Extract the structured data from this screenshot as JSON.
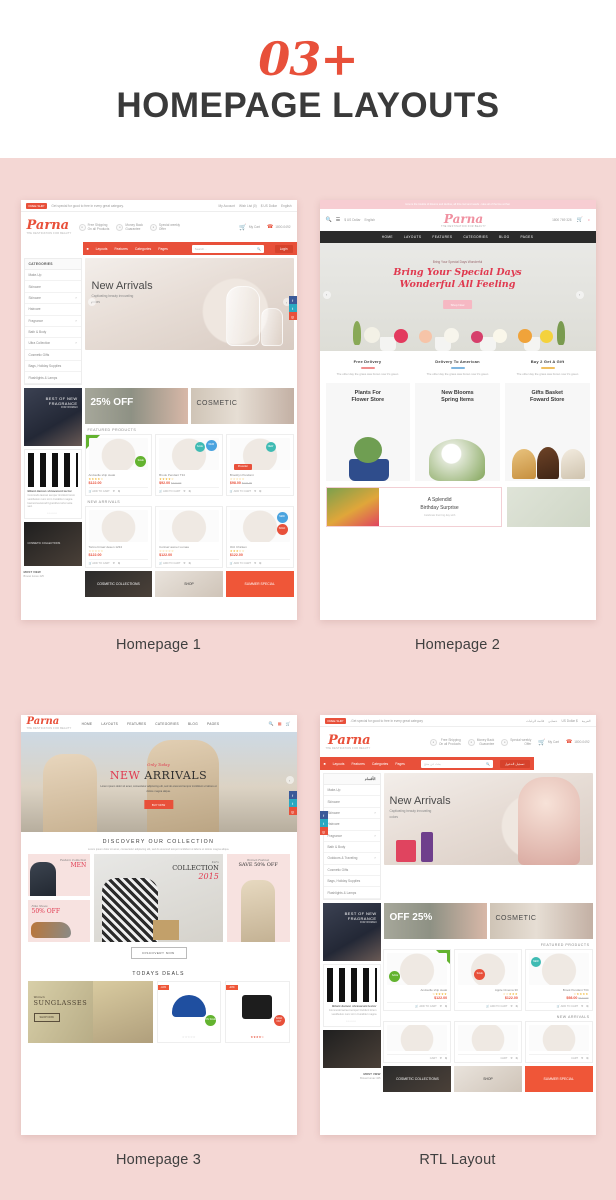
{
  "header": {
    "count": "03+",
    "title": "HOMEPAGE LAYOUTS"
  },
  "theme": {
    "brand": "Parna",
    "tagline": "THE DESTINATION FOR BEAUTY",
    "accent_red": "#e8503a",
    "accent_pink": "#f090a0",
    "board_bg": "#f4d7d4",
    "dark": "#2b2b2b"
  },
  "cells": [
    {
      "label": "Homepage 1",
      "variant": "homepage1"
    },
    {
      "label": "Homepage 2",
      "variant": "homepage2"
    },
    {
      "label": "Homepage 3",
      "variant": "homepage3"
    },
    {
      "label": "RTL Layout",
      "variant": "rtl"
    }
  ],
  "homepage1": {
    "topbar": {
      "badge": "FREE SHIP",
      "note": "Get special for good to free in every great category.",
      "links": [
        "My Account",
        "Wish List (0)",
        "$ US Dollar",
        "English"
      ]
    },
    "services": [
      {
        "title": "Free Shipping",
        "sub": "On all Products"
      },
      {
        "title": "Money Back",
        "sub": "Guarantee"
      },
      {
        "title": "Special weekly",
        "sub": "Offer"
      }
    ],
    "cart": {
      "label": "My Cart",
      "count": "0",
      "hotline_label": "Hotline:",
      "hotline": "1800-0492"
    },
    "nav": [
      "Layouts",
      "Features",
      "Categories",
      "Pages"
    ],
    "search_placeholder": "Search...",
    "login_label": "Login",
    "categories_title": "CATEGORIES",
    "categories": [
      "Make-Up",
      "Skincare",
      "Skincare",
      "Haircare",
      "Fragrance",
      "Bath & Body",
      "Ultra Collection",
      "Cosmetic Gifts",
      "Bags, Holiday Supplies",
      "Flashlights & Lamps"
    ],
    "hero": {
      "title": "New Arrivals",
      "sub": "Captivating  beauty  innovating",
      "sub2": "colors"
    },
    "banners": [
      {
        "t1": "BEST OF NEW",
        "t2": "FRAGRANCE",
        "t3": "FOR WOMAN"
      },
      {
        "t1": "Limited Time!",
        "big": "25% OFF",
        "t2": "ON ANY ORDER"
      },
      {
        "t1": "Nature",
        "big": "COSMETIC",
        "t2": "SHOP NOW"
      }
    ],
    "featured_title": "FEATURED PRODUCTS",
    "featured": [
      {
        "name": "Andouille ship steak",
        "stars": "★★★★☆",
        "price": "$122.00",
        "old": "",
        "badge": "SALE",
        "badge_kind": "grn",
        "flag": true
      },
      {
        "name": "Brook Pendant T34",
        "stars": "★★★★☆",
        "price": "$92.00",
        "old": "$122.00",
        "badge": "NEW",
        "badge_kind": "new",
        "badge2": "SALE"
      },
      {
        "name": "Brooklyn Pendant",
        "stars": "☆☆☆☆☆",
        "price": "$98.00",
        "old": "$122.00",
        "badge": "NEW",
        "badge_kind": "tl",
        "ribbon": "Preorder"
      }
    ],
    "arrivals_title": "NEW ARRIVALS",
    "arrivals": [
      {
        "name": "Torino bimaz desen 1234",
        "stars": "☆☆☆☆☆",
        "price": "$122.00"
      },
      {
        "name": "Corinaz aomer Lumaa",
        "stars": "☆☆☆☆☆",
        "price": "$122.00"
      },
      {
        "name": "Otiz Chicken",
        "stars": "★★★☆☆",
        "price": "$122.00"
      }
    ],
    "side": {
      "promo1": {
        "t1": "BEST OF NEW",
        "t2": "FRAGRANCE",
        "t3": "FOR WOMAN"
      },
      "blog_title": "Bilant damon shravarunt lector",
      "blog_text": "Commodo laoreet semper tincidunt lorem vestibulum nunc sit in Curabitur magna lowmod euismod hyperdrive tortor ante sed.",
      "most_view": "MOST VIEW",
      "most_view_item": "Brooet lumax 425"
    },
    "bottom_banners": [
      "COSMETIC COLLECTIONS",
      "SHOP",
      "SUMMER SPECIAL"
    ],
    "social": [
      "f",
      "t",
      "g"
    ]
  },
  "homepage2": {
    "topbar_note": "How is the trouble of blooms and decline, all this cool and needs - take all of the line at that",
    "header_left": [
      "$ US Dollar",
      "English"
    ],
    "hotline": "1800 769 328",
    "cart_count": "0",
    "nav": [
      "HOME",
      "LAYOUTS",
      "FEATURES",
      "CATEGORIES",
      "BLOG",
      "PAGES"
    ],
    "hero": {
      "sup": "Bring Your Special Days Wonderful",
      "title_line1": "Bring Your Special Days",
      "title_line2": "Wonderful All Feeling",
      "button": "Shop Now"
    },
    "features": [
      {
        "title": "Free Delivery",
        "desc": "The other day the grass was brown now it's green",
        "color": "#f08e8e"
      },
      {
        "title": "Delivery To American",
        "desc": "The other day the grass was brown now it's green",
        "color": "#7fb6e0"
      },
      {
        "title": "Buy 2 Get A Gift",
        "desc": "The other day the grass was brown now it's green",
        "color": "#f0c060"
      }
    ],
    "cards": [
      {
        "line1": "Plants For",
        "line2": "Flower Store"
      },
      {
        "line1": "New Blooms",
        "line2": "Spring Items"
      },
      {
        "line1": "Gifts Basket",
        "line2": "Foward Store"
      }
    ],
    "wide": {
      "line1": "A Splendid",
      "line2": "Birthday Surprise",
      "sub": "Celebrate their big day with"
    }
  },
  "homepage3": {
    "nav": [
      "HOME",
      "LAYOUTS",
      "FEATURES",
      "CATEGORIES",
      "BLOG",
      "PAGES"
    ],
    "icons": [
      "search-icon",
      "grid-icon",
      "cart-icon"
    ],
    "hero": {
      "sup": "Only Today",
      "title_plain": "NEW ",
      "title_accent": "ARRIVALS",
      "desc": "Lorem ipsum dolor sit amet, consectetur adipiscing elit, sed do eiusmod tempor incididunt ut labore et dolore magna aliqua.",
      "button": "BUY NOW"
    },
    "section": {
      "title": "DISCOVERY OUR COLLECTION",
      "desc": "Lorem ipsum dolor sit amet, consectetur adipiscing elit, sed do eiusmod tempor incididunt ut labore et dolore magna aliqua."
    },
    "tiles": [
      {
        "l1": "Fashion Collection",
        "l2": "MEN"
      },
      {
        "l1": "Nike Shoes",
        "l2": "50% OFF"
      },
      {
        "l1": "Kid's",
        "l2": "COLLECTION",
        "l3": "2015"
      },
      {
        "l1": "Women Fashion",
        "l2": "SAVE 50% OFF"
      }
    ],
    "discovery_button": "DISCOVERY NOW",
    "deals_title": "TODAYS DEALS",
    "deal_banner": {
      "l1": "Women",
      "l2": "SUNGLASSES",
      "button": "SHOP NOW"
    },
    "deals": [
      {
        "tag": "-10%",
        "stars": "☆☆☆☆☆",
        "badge": "ON SALE"
      },
      {
        "tag": "-20%",
        "stars": "★★★★☆",
        "badge": "SOLD OUT"
      }
    ]
  },
  "rtl": {
    "topbar_links": [
      "العربية",
      "$ US Dollar",
      "حسابي",
      "قائمة الرغبات"
    ],
    "topbar_note": "Get special for good to free in every great category.",
    "topbar_badge": "FREE SHIP",
    "services": [
      {
        "title": "Free Shipping",
        "sub": "On all Products"
      },
      {
        "title": "Money Back",
        "sub": "Guarantee"
      },
      {
        "title": "Special weekly",
        "sub": "Offer"
      }
    ],
    "cart": {
      "label": "My Cart",
      "count": "0",
      "hotline_label": "Hotline:",
      "hotline": "1800-0492"
    },
    "nav": [
      "Layouts",
      "Features",
      "Categories",
      "Pages"
    ],
    "search_placeholder": "بحث عن منتج",
    "login_label": "تسجيل الدخول",
    "categories_title": "الأقسام",
    "categories": [
      "Make-Up",
      "Skincare",
      "Skincare",
      "Haircare",
      "Fragrance",
      "Bath & Body",
      "Outdoors & Traveling",
      "Cosmetic Gifts",
      "Bags, Holiday Supplies",
      "Flashlights & Lamps"
    ],
    "hero": {
      "title": "New Arrivals",
      "sub": "Captivating  beauty  innovating",
      "sub2": "colors"
    },
    "featured_title": "FEATURED PRODUCTS",
    "arrivals_title": "NEW ARRIVALS",
    "featured": [
      {
        "name": "Brook Pendant T34",
        "stars": "★★★★☆",
        "price": "$98.00",
        "old": "$122.00"
      },
      {
        "name": "Apple Cinema 30",
        "stars": "★★★☆☆",
        "price": "$122.00",
        "old": ""
      },
      {
        "name": "Andouille ship steak",
        "stars": "★★★★☆",
        "price": "$122.00",
        "old": ""
      }
    ],
    "side": {
      "promo1": {
        "t1": "BEST OF NEW",
        "t2": "FRAGRANCE",
        "t3": "FOR WOMAN"
      },
      "blog_title": "Bilant damon shravarunt lector",
      "blog_text": "Commodo laoreet semper tincidunt lorem vestibulum nunc sit in Curabitur magna.",
      "most_view": "MOST VIEW",
      "most_view_item": "Brooet lumax 425"
    },
    "bottom_banners": [
      "SUMMER SPECIAL",
      "SHOP",
      "COSMETIC COLLECTIONS"
    ]
  }
}
